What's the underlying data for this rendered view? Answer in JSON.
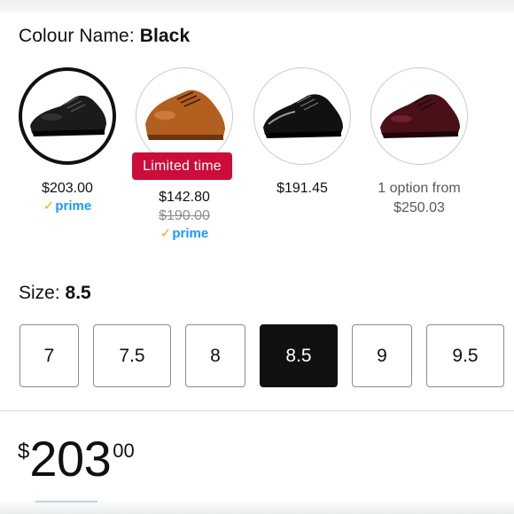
{
  "colour": {
    "label": "Colour Name:",
    "value": "Black"
  },
  "swatches": [
    {
      "name": "black-leather",
      "price": "$203.00",
      "prime": "prime",
      "selected": true
    },
    {
      "name": "tan-leather",
      "badge": "Limited time",
      "price": "$142.80",
      "old_price": "$190.00",
      "prime": "prime"
    },
    {
      "name": "black-patent",
      "price": "$191.45"
    },
    {
      "name": "burgundy-leather",
      "option_line1": "1 option from",
      "option_line2": "$250.03"
    }
  ],
  "size": {
    "label": "Size:",
    "value": "8.5",
    "options": [
      "7",
      "7.5",
      "8",
      "8.5",
      "9",
      "9.5"
    ],
    "selected": "8.5"
  },
  "price": {
    "symbol": "$",
    "whole": "203",
    "fraction": "00"
  },
  "colors": {
    "badge_red": "#cc0c39",
    "prime_blue": "#1a98ff",
    "prime_check": "#f7a623"
  }
}
